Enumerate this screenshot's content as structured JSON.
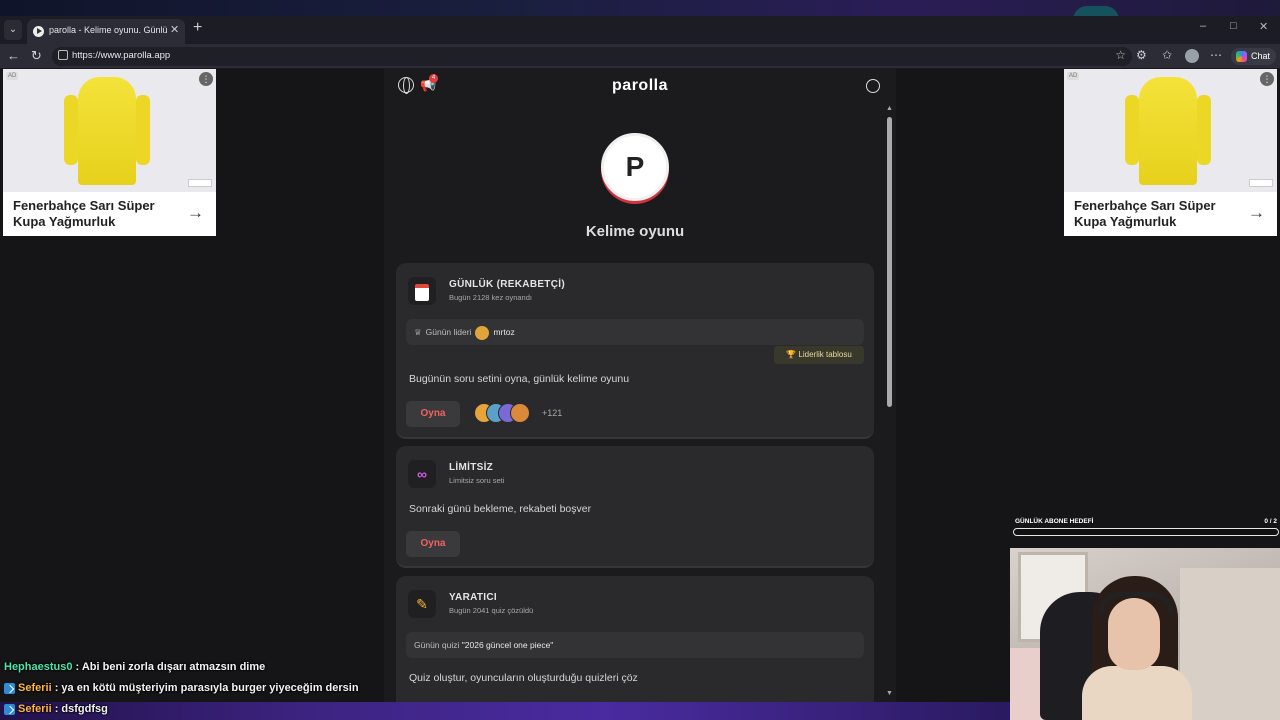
{
  "browser": {
    "tab_title": "parolla - Kelime oyunu. Günlük ke",
    "url": "https://www.parolla.app",
    "chat_label": "Chat"
  },
  "ads": {
    "left": {
      "badge": "AD",
      "title": "Fenerbahçe Sarı Süper Kupa Yağmurluk"
    },
    "right": {
      "badge": "AD",
      "title": "Fenerbahçe Sarı Süper Kupa Yağmurluk"
    }
  },
  "game": {
    "logo": "parolla",
    "notification_count": "4",
    "avatar_letter": "P",
    "title": "Kelime oyunu",
    "cards": {
      "daily": {
        "title": "GÜNLÜK (REKABETÇİ)",
        "subtitle": "Bugün 2128 kez oynandı",
        "leader_label": "Günün lideri",
        "leader_name": "mrtoz",
        "leaderboard_label": "🏆 Liderlik tablosu",
        "description": "Bugünün soru setini oyna, günlük kelime oyunu",
        "play_label": "Oyna",
        "players_more": "+121"
      },
      "unlimited": {
        "title": "LİMİTSİZ",
        "subtitle": "Limitsiz soru seti",
        "description": "Sonraki günü bekleme, rekabeti boşver",
        "play_label": "Oyna"
      },
      "creator": {
        "title": "YARATICI",
        "subtitle": "Bugün 2041 quiz çözüldü",
        "quiz_label": "Günün quizi",
        "quiz_name": "\"2026 güncel one piece\"",
        "description": "Quiz oluştur, oyuncuların oluşturduğu quizleri çöz"
      }
    }
  },
  "stream": {
    "goal_label": "GÜNLÜK ABONE HEDEFİ",
    "goal_count": "0  / 2",
    "goal_progress": 0,
    "chat": [
      {
        "user": "Hephaestus0",
        "sep": " : ",
        "message": "Abi beni zorla dışarı atmazsın dime",
        "color": "#4fe3a8",
        "badge": false
      },
      {
        "user": "Seferii",
        "sep": " : ",
        "message": "ya en kötü müşteriyim parasıyla burger yiyeceğim dersin",
        "color": "#ffb83a",
        "badge": true
      },
      {
        "user": "Seferii",
        "sep": " : ",
        "message": "dsfgdfsg",
        "color": "#ffb83a",
        "badge": true
      }
    ]
  }
}
